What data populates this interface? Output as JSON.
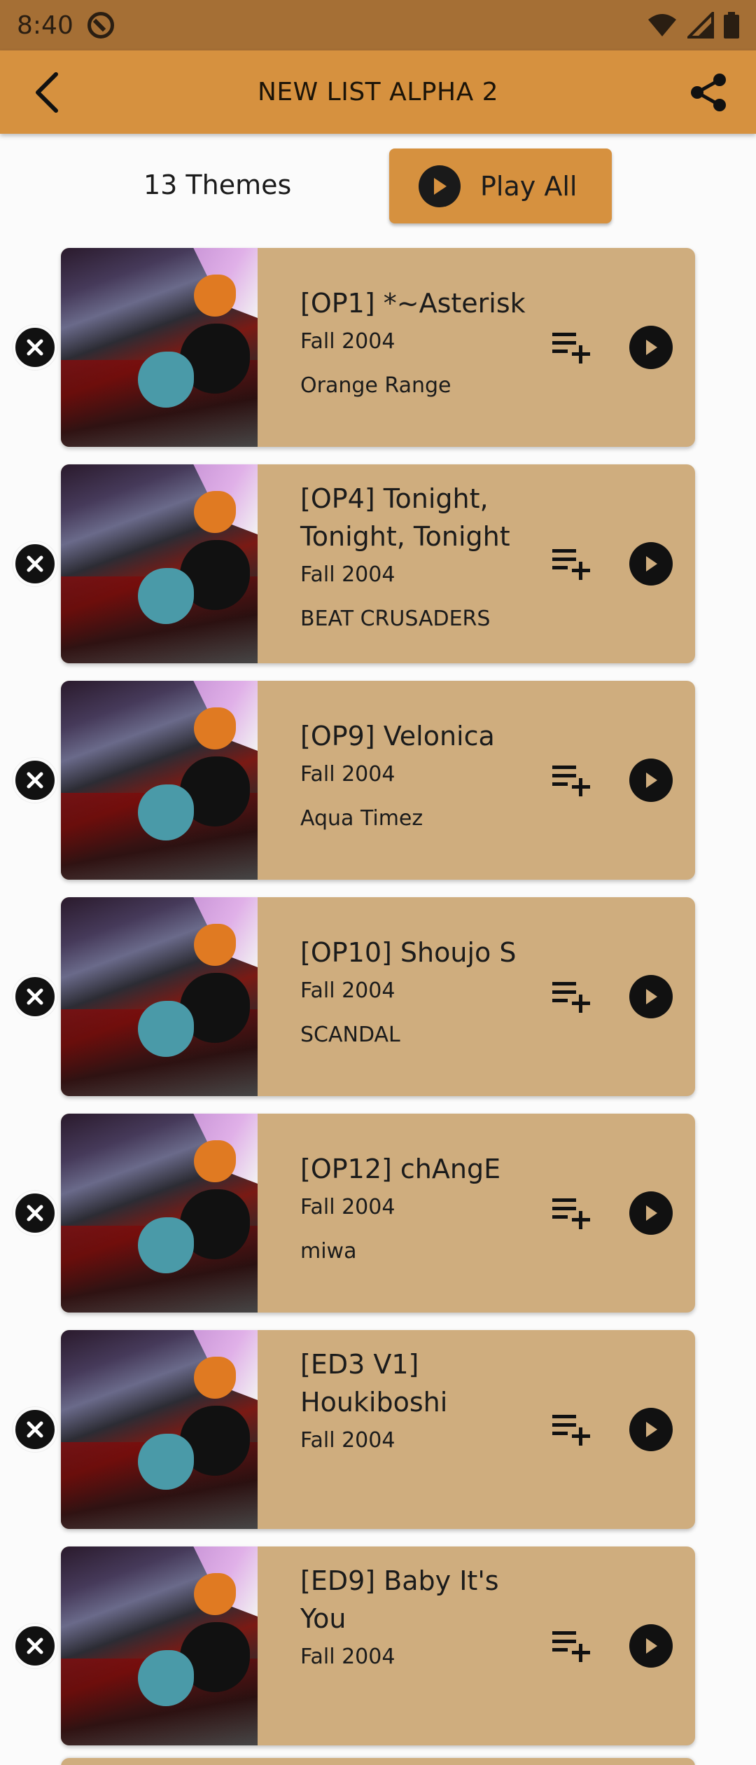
{
  "status_bar": {
    "time": "8:40",
    "icons": [
      "at-sign-icon",
      "wifi-icon",
      "signal-icon",
      "battery-icon"
    ]
  },
  "app_bar": {
    "title": "NEW LIST ALPHA 2",
    "back_icon": "back-arrow-icon",
    "share_icon": "share-icon"
  },
  "summary": {
    "themes_count": "13 Themes",
    "play_all_label": "Play All"
  },
  "colors": {
    "status_bar": "#a56f35",
    "app_bar": "#d6913f",
    "card": "#cfad7e",
    "background": "#fbfbfb"
  },
  "themes": [
    {
      "title": "[OP1] *~Asterisk",
      "season": "Fall 2004",
      "artist": "Orange Range"
    },
    {
      "title": "[OP4] Tonight, Tonight, Tonight",
      "season": "Fall 2004",
      "artist": "BEAT CRUSADERS"
    },
    {
      "title": "[OP9] Velonica",
      "season": "Fall 2004",
      "artist": "Aqua Timez"
    },
    {
      "title": "[OP10] Shoujo S",
      "season": "Fall 2004",
      "artist": "SCANDAL"
    },
    {
      "title": "[OP12] chAngE",
      "season": "Fall 2004",
      "artist": "miwa"
    },
    {
      "title": "[ED3 V1] Houkiboshi",
      "season": "Fall 2004",
      "artist": ""
    },
    {
      "title": "[ED9] Baby It's You",
      "season": "Fall 2004",
      "artist": ""
    }
  ]
}
